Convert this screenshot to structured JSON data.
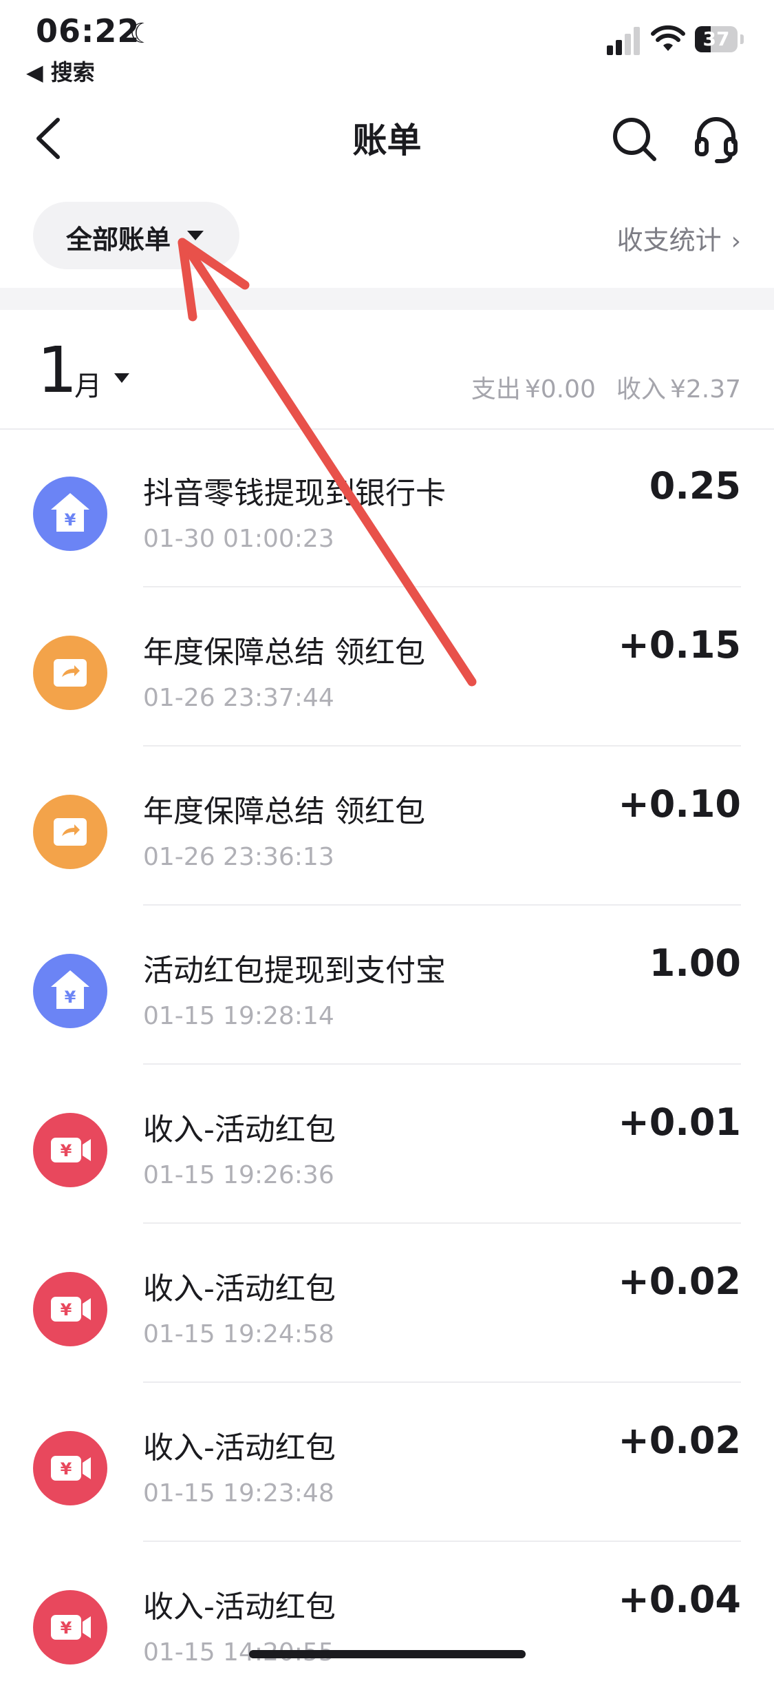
{
  "status_bar": {
    "time": "06:22",
    "back_app": "◀ 搜索",
    "battery": "37"
  },
  "nav": {
    "title": "账单",
    "back_icon": "chevron-left-icon",
    "search_icon": "search-icon",
    "service_icon": "headset-icon"
  },
  "filter": {
    "label": "全部账单",
    "stats_label": "收支统计"
  },
  "month": {
    "number": "1",
    "unit": "月",
    "expense_label": "支出",
    "expense_value": "¥0.00",
    "income_label": "收入",
    "income_value": "¥2.37"
  },
  "transactions": [
    {
      "title": "抖音零钱提现到银行卡",
      "time": "01-30 01:00:23",
      "amount": "0.25",
      "icon": "withdraw-icon"
    },
    {
      "title": "年度保障总结 领红包",
      "time": "01-26 23:37:44",
      "amount": "+0.15",
      "icon": "wallet-icon"
    },
    {
      "title": "年度保障总结 领红包",
      "time": "01-26 23:36:13",
      "amount": "+0.10",
      "icon": "wallet-icon"
    },
    {
      "title": "活动红包提现到支付宝",
      "time": "01-15 19:28:14",
      "amount": "1.00",
      "icon": "withdraw-icon"
    },
    {
      "title": "收入-活动红包",
      "time": "01-15 19:26:36",
      "amount": "+0.01",
      "icon": "video-yuan-icon"
    },
    {
      "title": "收入-活动红包",
      "time": "01-15 19:24:58",
      "amount": "+0.02",
      "icon": "video-yuan-icon"
    },
    {
      "title": "收入-活动红包",
      "time": "01-15 19:23:48",
      "amount": "+0.02",
      "icon": "video-yuan-icon"
    },
    {
      "title": "收入-活动红包",
      "time": "01-15 14:20:55",
      "amount": "+0.04",
      "icon": "video-yuan-icon"
    }
  ],
  "colors": {
    "withdraw": "#6b84f5",
    "wallet": "#f3a34a",
    "video": "#e8485d",
    "annotation": "#e8514a"
  }
}
